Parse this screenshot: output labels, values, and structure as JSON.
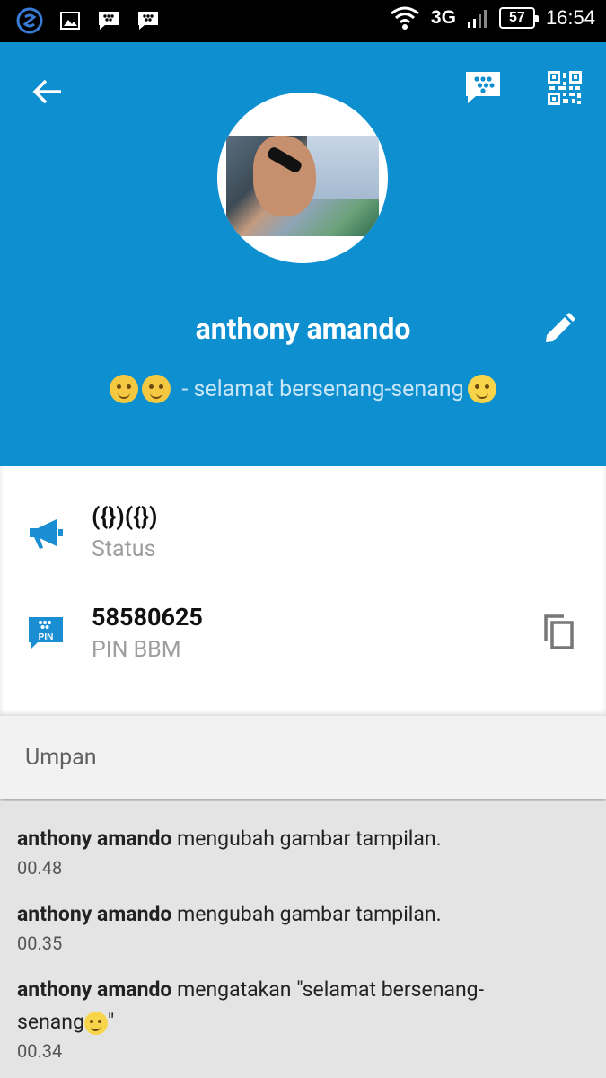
{
  "statusbar": {
    "network": "3G",
    "battery": "57",
    "time": "16:54",
    "icons": [
      "s-app-icon",
      "gallery-icon",
      "bbm-notification-icon",
      "bbm-notification-icon",
      "wifi-icon",
      "signal-icon",
      "battery-icon"
    ]
  },
  "header": {
    "background": "#0e8fd0",
    "name": "anthony amando",
    "tagline": "- selamat bersenang-senang"
  },
  "info": {
    "status_value": "({})({})",
    "status_label": "Status",
    "pin_value": "58580625",
    "pin_label": "PIN BBM",
    "pin_badge": "PIN"
  },
  "feed_section": {
    "label": "Umpan"
  },
  "feed": [
    {
      "user": "anthony amando",
      "action": " mengubah gambar tampilan.",
      "time": "00.48"
    },
    {
      "user": "anthony amando",
      "action": " mengubah gambar tampilan.",
      "time": "00.35"
    },
    {
      "user": "anthony amando",
      "action": " mengatakan \"selamat bersenang-senang",
      "action_end": "\"",
      "time": "00.34"
    }
  ]
}
